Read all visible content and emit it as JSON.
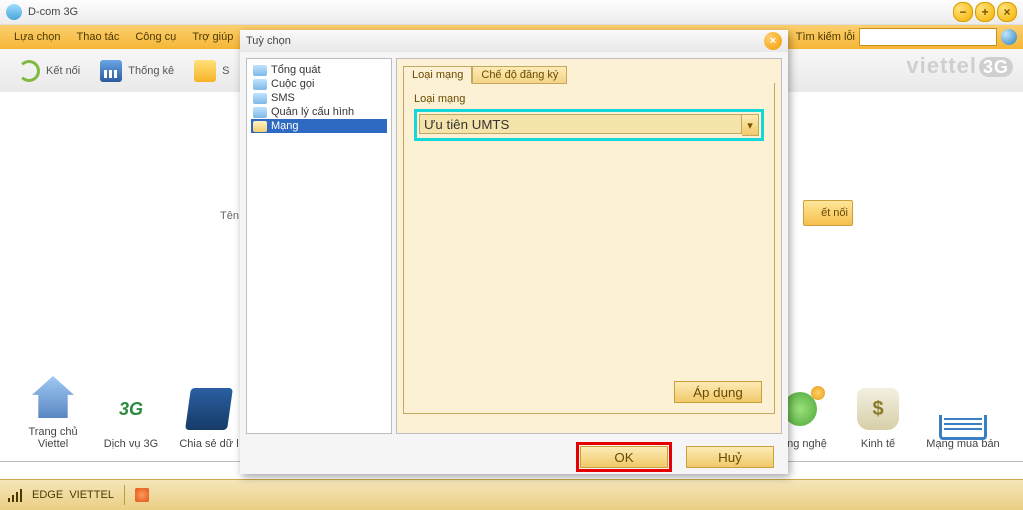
{
  "title": "D-com 3G",
  "menubar": {
    "items": [
      "Lựa chọn",
      "Thao tác",
      "Công cụ",
      "Trợ giúp"
    ],
    "search_label": "Tìm kiếm lỗi",
    "search_value": ""
  },
  "toolbar": {
    "connect": "Kết nối",
    "stats": "Thống kê",
    "s": "S"
  },
  "brand": "viettel",
  "brand_suffix": "3G",
  "behind_label": "Tên cấu h",
  "connect_peek": "ết nối",
  "apps": {
    "home": "Trang chủ Viettel",
    "g3": "Dịch vụ 3G",
    "share": "Chia sẻ dữ l",
    "tech": "Công nghệ",
    "econ": "Kinh tế",
    "shop": "Mạng mua bán"
  },
  "status": {
    "mode": "EDGE",
    "carrier": "VIETTEL"
  },
  "dialog": {
    "title": "Tuỳ chọn",
    "tree": [
      "Tổng quát",
      "Cuộc gọi",
      "SMS",
      "Quản lý cấu hình",
      "Mạng"
    ],
    "tabs": {
      "t1": "Loại mạng",
      "t2": "Chế độ đăng ký"
    },
    "group_label": "Loại mạng",
    "network_value": "Ưu tiên UMTS",
    "apply": "Áp dụng",
    "ok": "OK",
    "cancel": "Huỷ"
  }
}
